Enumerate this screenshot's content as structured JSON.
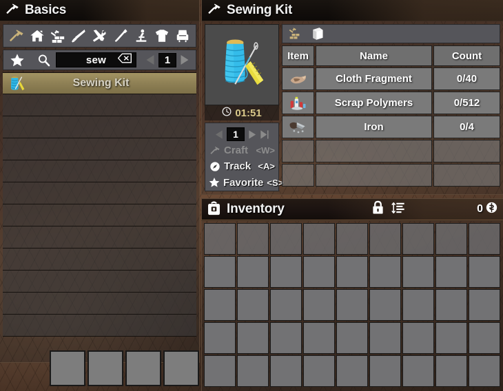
{
  "left_window": {
    "title": "Basics",
    "title_icon": "hammer-icon",
    "categories": [
      {
        "name": "category-basics",
        "icon": "hammer-icon",
        "selected": true
      },
      {
        "name": "category-home",
        "icon": "house-icon",
        "selected": false
      },
      {
        "name": "category-building",
        "icon": "building-block-icon",
        "selected": false
      },
      {
        "name": "category-weapons",
        "icon": "knife-icon",
        "selected": false
      },
      {
        "name": "category-tools",
        "icon": "tools-icon",
        "selected": false
      },
      {
        "name": "category-food",
        "icon": "fork-icon",
        "selected": false
      },
      {
        "name": "category-chemistry",
        "icon": "microscope-icon",
        "selected": false
      },
      {
        "name": "category-clothing",
        "icon": "shirt-icon",
        "selected": false
      },
      {
        "name": "category-decor",
        "icon": "armchair-icon",
        "selected": false
      }
    ],
    "search": {
      "favorite_icon": "star-icon",
      "search_icon": "magnifier-icon",
      "value": "sew",
      "placeholder": "",
      "clear_icon": "backspace-icon",
      "prev_icon": "left-arrow-icon",
      "page": "1",
      "next_icon": "right-arrow-icon"
    },
    "recipes": [
      {
        "name": "Sewing Kit",
        "icon": "sewing-kit-icon",
        "selected": true
      },
      {
        "name": "",
        "icon": "",
        "selected": false
      },
      {
        "name": "",
        "icon": "",
        "selected": false
      },
      {
        "name": "",
        "icon": "",
        "selected": false
      },
      {
        "name": "",
        "icon": "",
        "selected": false
      },
      {
        "name": "",
        "icon": "",
        "selected": false
      },
      {
        "name": "",
        "icon": "",
        "selected": false
      },
      {
        "name": "",
        "icon": "",
        "selected": false
      },
      {
        "name": "",
        "icon": "",
        "selected": false
      },
      {
        "name": "",
        "icon": "",
        "selected": false
      },
      {
        "name": "",
        "icon": "",
        "selected": false
      },
      {
        "name": "",
        "icon": "",
        "selected": false
      }
    ]
  },
  "hotbar": {
    "slots": [
      "",
      "",
      "",
      ""
    ]
  },
  "right_window": {
    "title": "Sewing Kit",
    "title_icon": "hammer-icon",
    "product": {
      "icon": "sewing-kit-icon",
      "craft_time": "01:51",
      "time_icon": "clock-icon"
    },
    "controls": {
      "prev_icon": "left-arrow-icon",
      "quantity": "1",
      "next_icon": "right-arrow-icon",
      "last_icon": "right-arrow-end-icon",
      "actions": [
        {
          "label": "Craft",
          "key": "<W>",
          "icon": "hammer-icon",
          "disabled": true
        },
        {
          "label": "Track",
          "key": "<A>",
          "icon": "compass-icon",
          "disabled": false
        },
        {
          "label": "Favorite",
          "key": "<S>",
          "icon": "star-icon",
          "disabled": false
        }
      ]
    },
    "tabs": [
      {
        "name": "tab-ingredients",
        "icon": "build-hammer-icon",
        "selected": true
      },
      {
        "name": "tab-description",
        "icon": "book-icon",
        "selected": false
      }
    ],
    "table": {
      "headers": [
        "Item",
        "Name",
        "Count"
      ],
      "rows": [
        {
          "icon": "cloth-fragment-icon",
          "name": "Cloth Fragment",
          "count": "0/40"
        },
        {
          "icon": "scrap-polymers-icon",
          "name": "Scrap Polymers",
          "count": "0/512"
        },
        {
          "icon": "iron-icon",
          "name": "Iron",
          "count": "0/4"
        },
        {
          "icon": "",
          "name": "",
          "count": ""
        },
        {
          "icon": "",
          "name": "",
          "count": ""
        }
      ]
    }
  },
  "inventory": {
    "title": "Inventory",
    "title_icon": "backpack-icon",
    "lock_icon": "lock-icon",
    "sort_icon": "sort-icon",
    "money": "0",
    "money_icon": "coin-icon",
    "columns": 9,
    "rows": 5
  },
  "colors": {
    "selected_row": "#8e8055",
    "accent_gold": "#d9c98a",
    "panel_gray": "#55555a",
    "cell_gray": "#7a7a7a",
    "slot_gray": "#727274",
    "border_brown": "#5a4636"
  }
}
